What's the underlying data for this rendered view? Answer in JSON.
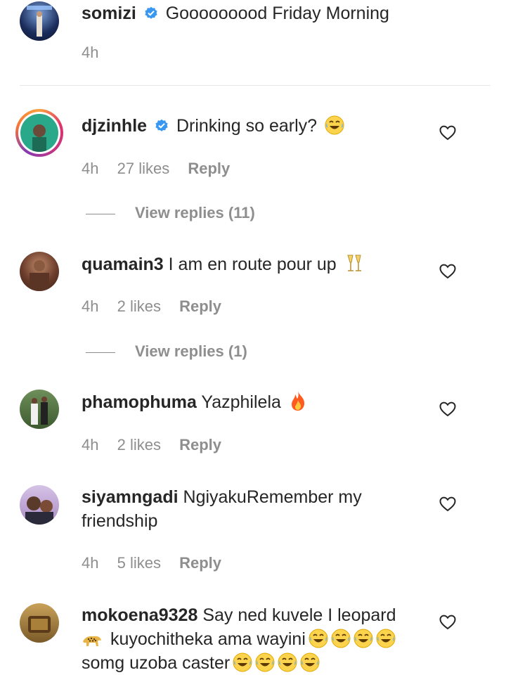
{
  "post": {
    "username": "somizi",
    "text": "Gooooooood Friday Morning",
    "time": "4h"
  },
  "comments": [
    {
      "username": "djzinhle",
      "text": "Drinking so early? ",
      "time": "4h",
      "likes": "27 likes",
      "reply": "Reply",
      "view_replies": "View replies (11)"
    },
    {
      "username": "quamain3",
      "text": "I am en route pour up ",
      "time": "4h",
      "likes": "2 likes",
      "reply": "Reply",
      "view_replies": "View replies (1)"
    },
    {
      "username": "phamophuma",
      "text": "Yazphilela ",
      "time": "4h",
      "likes": "2 likes",
      "reply": "Reply"
    },
    {
      "username": "siyamngadi",
      "text_line1": "NgiyakuRemember my",
      "text_line2": "friendship",
      "time": "4h",
      "likes": "5 likes",
      "reply": "Reply"
    },
    {
      "username": "mokoena9328",
      "text_line1": "Say ned kuvele I leopard",
      "text_line2": "kuyochitheka ama wayini",
      "text_line3": "somg uzoba caster"
    }
  ],
  "icons": {
    "verified": "verified-badge-icon",
    "heart": "heart-outline-icon",
    "laugh": "tears-of-joy-emoji",
    "champagne": "clinking-glasses-emoji",
    "fire": "fire-emoji",
    "leopard": "leopard-emoji"
  },
  "colors": {
    "verified": "#3897f0",
    "text": "#262626",
    "meta": "#8e8e8e"
  }
}
